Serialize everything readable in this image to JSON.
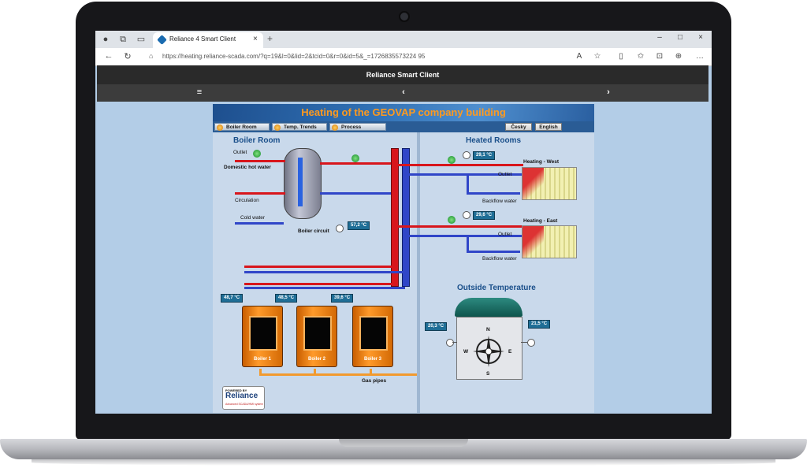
{
  "browser": {
    "tab_title": "Reliance 4 Smart Client",
    "tab_close": "×",
    "new_tab": "+",
    "url": "https://heating.reliance-scada.com/?q=19&l=0&lid=2&tcid=0&r=0&id=5&_=1726835573224 95",
    "window_min": "–",
    "window_max": "□",
    "window_close": "×"
  },
  "app": {
    "header_title": "Reliance Smart Client",
    "menu_glyph": "≡",
    "back_glyph": "‹",
    "forward_glyph": "›"
  },
  "scada": {
    "title": "Heating of the GEOVAP company building",
    "menu": {
      "boiler_room": "Boiler Room",
      "temp_trends": "Temp. Trends",
      "process": "Process",
      "cesky": "Česky",
      "english": "English"
    },
    "boiler_room": {
      "title": "Boiler Room",
      "outlet": "Outlet",
      "domestic_hot_water": "Domestic hot water",
      "circulation": "Circulation",
      "cold_water": "Cold water",
      "boiler_circuit": "Boiler circuit",
      "boiler_circuit_temp": "57,2 °C",
      "gas_pipes": "Gas pipes",
      "boilers": [
        {
          "name": "Boiler 1",
          "temp": "48,7 °C"
        },
        {
          "name": "Boiler 2",
          "temp": "48,5 °C"
        },
        {
          "name": "Boiler 3",
          "temp": "39,6 °C"
        }
      ]
    },
    "heated_rooms": {
      "title": "Heated Rooms",
      "west": {
        "name": "Heating - West",
        "temp": "29,1 °C",
        "outlet": "Outlet",
        "backflow": "Backflow water"
      },
      "east": {
        "name": "Heating - East",
        "temp": "29,6 °C",
        "outlet": "Outlet",
        "backflow": "Backflow water"
      }
    },
    "outside": {
      "title": "Outside Temperature",
      "left_temp": "20,3 °C",
      "right_temp": "21,5 °C",
      "compass": {
        "n": "N",
        "s": "S",
        "e": "E",
        "w": "W"
      }
    },
    "logo": {
      "powered_by": "POWERED BY",
      "brand": "Reliance",
      "tagline": "Advanced SCADA/HMI system"
    }
  },
  "colors": {
    "hot_pipe": "#d8161c",
    "cold_pipe": "#3046c8",
    "gas_pipe": "#f29a2e",
    "title_text": "#ff9a1e",
    "section_title": "#1a4f8a"
  },
  "icons": [
    "profile-icon",
    "workspaces-icon",
    "tab-actions-icon",
    "back-icon",
    "refresh-icon",
    "lock-icon",
    "read-aloud-icon",
    "favorite-icon",
    "split-screen-icon",
    "favorites-icon",
    "collections-icon",
    "extensions-icon",
    "more-icon",
    "compass-icon"
  ]
}
